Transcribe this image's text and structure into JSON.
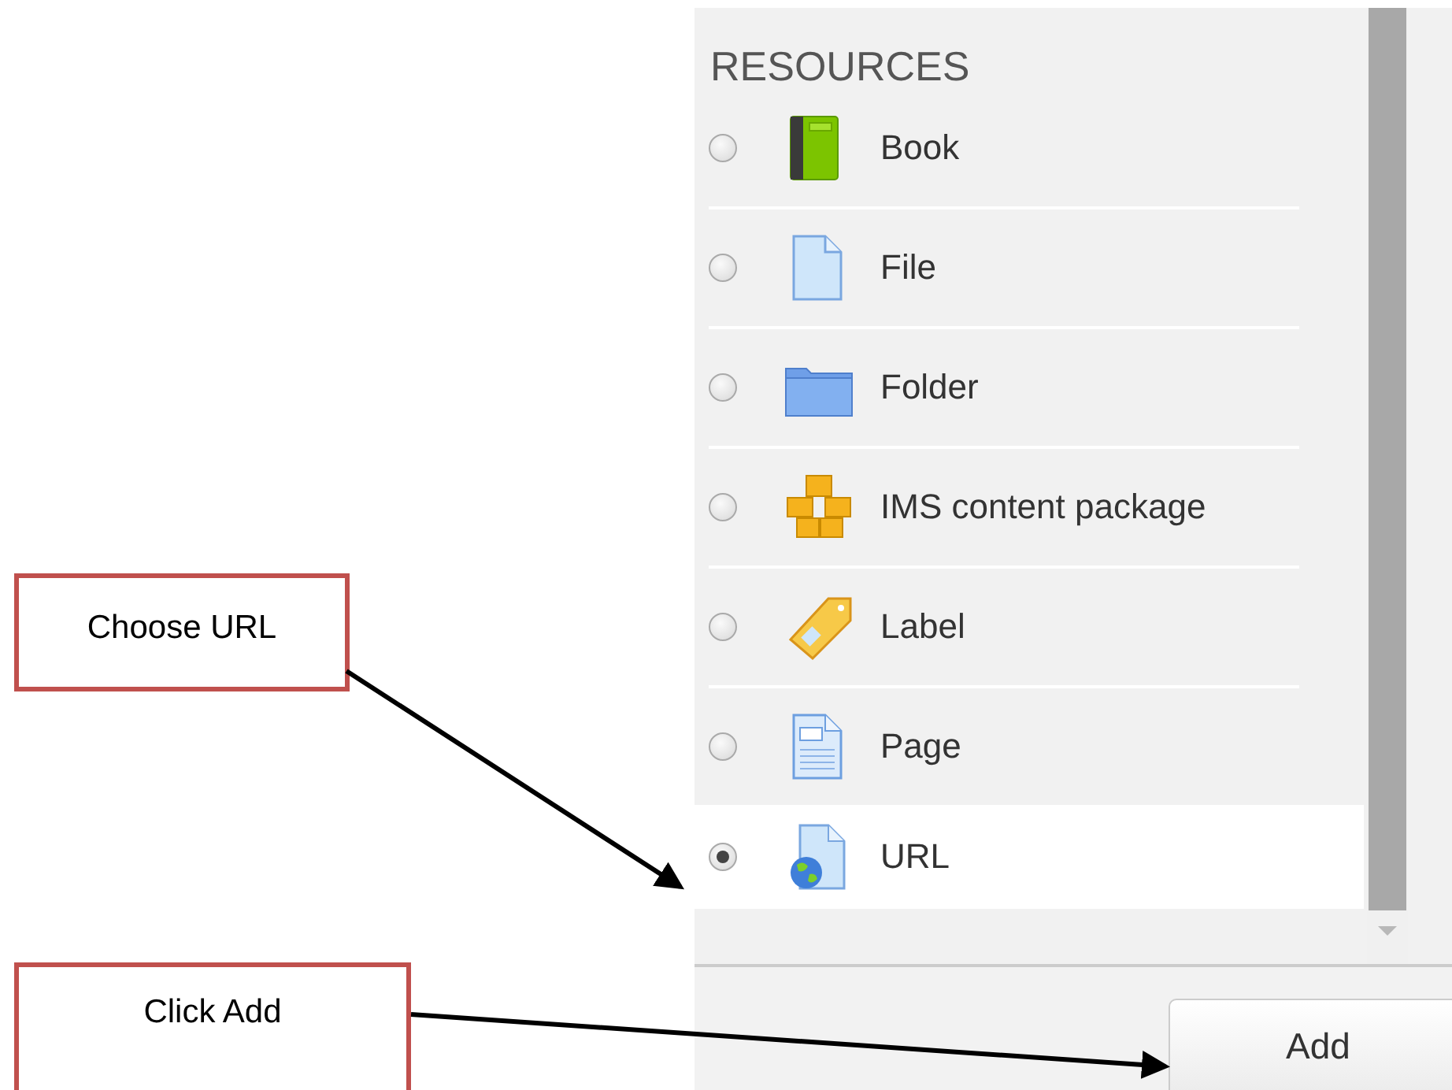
{
  "chooser": {
    "heading": "RESOURCES",
    "items": [
      {
        "label": "Book",
        "kind": "book",
        "selected": false
      },
      {
        "label": "File",
        "kind": "file",
        "selected": false
      },
      {
        "label": "Folder",
        "kind": "folder",
        "selected": false
      },
      {
        "label": "IMS content package",
        "kind": "package",
        "selected": false
      },
      {
        "label": "Label",
        "kind": "label",
        "selected": false
      },
      {
        "label": "Page",
        "kind": "page",
        "selected": false
      },
      {
        "label": "URL",
        "kind": "url",
        "selected": true
      }
    ],
    "add_button": "Add"
  },
  "callouts": [
    {
      "text": "Choose URL",
      "kind": "choose"
    },
    {
      "text": "Click Add",
      "kind": "add"
    }
  ]
}
